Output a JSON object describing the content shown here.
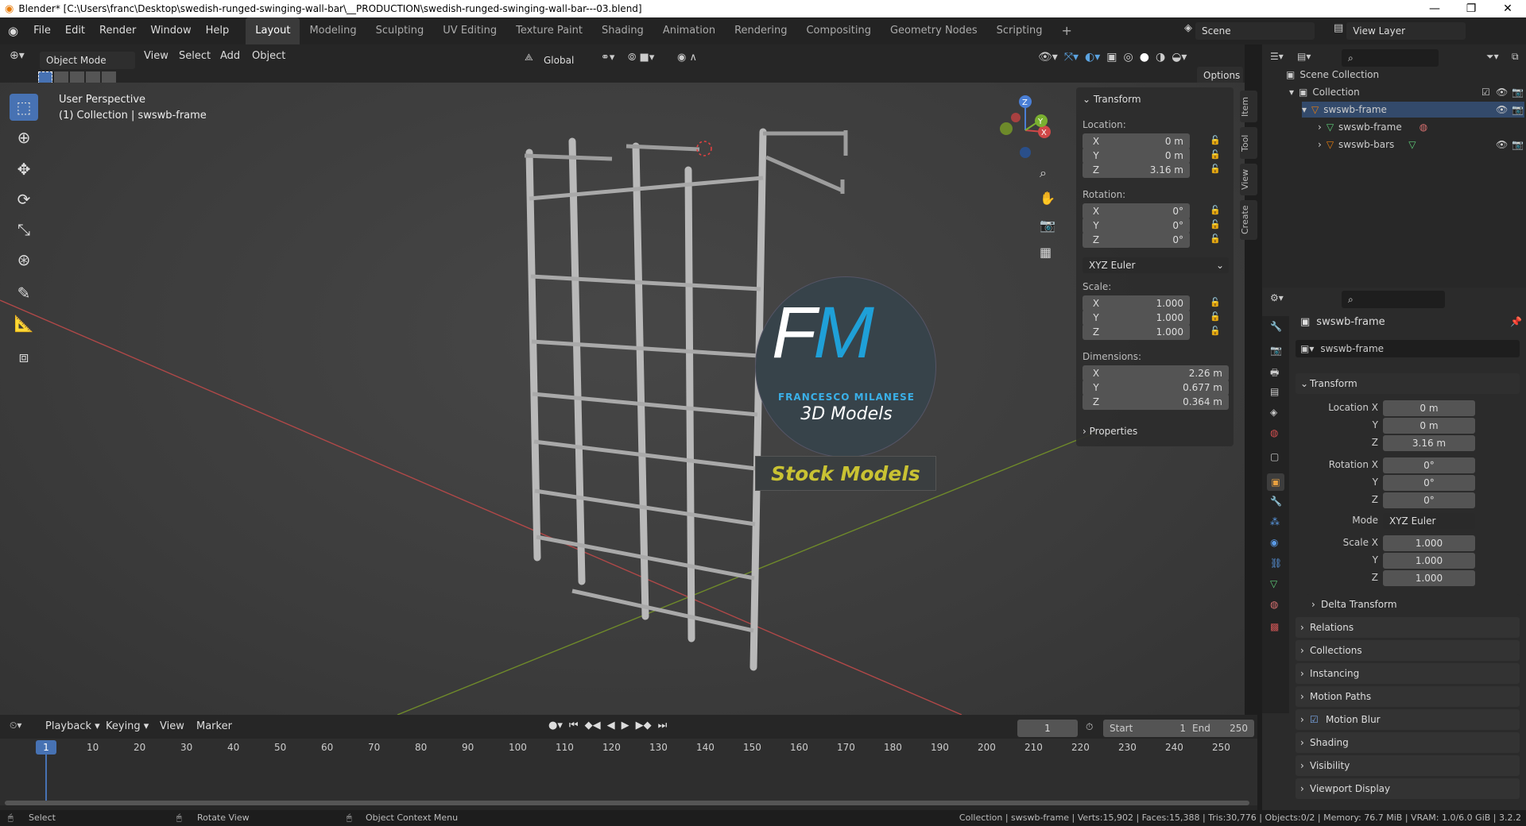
{
  "window": {
    "title": "Blender* [C:\\Users\\franc\\Desktop\\swedish-runged-swinging-wall-bar\\__PRODUCTION\\swedish-runged-swinging-wall-bar---03.blend]"
  },
  "menus": [
    "File",
    "Edit",
    "Render",
    "Window",
    "Help"
  ],
  "workspaces": [
    "Layout",
    "Modeling",
    "Sculpting",
    "UV Editing",
    "Texture Paint",
    "Shading",
    "Animation",
    "Rendering",
    "Compositing",
    "Geometry Nodes",
    "Scripting"
  ],
  "scene": "Scene",
  "view_layer": "View Layer",
  "viewport": {
    "mode": "Object Mode",
    "menus": [
      "View",
      "Select",
      "Add",
      "Object"
    ],
    "transform_orientation": "Global",
    "options": "Options",
    "perspective": "User Perspective",
    "collection_info": "(1) Collection | swswb-frame"
  },
  "watermark": {
    "letters": "FM",
    "name": "FRANCESCO MILANESE",
    "sub": "3D Models",
    "banner": "Stock Models"
  },
  "npanel": {
    "title": "Transform",
    "location_label": "Location:",
    "location": [
      {
        "ax": "X",
        "v": "0 m"
      },
      {
        "ax": "Y",
        "v": "0 m"
      },
      {
        "ax": "Z",
        "v": "3.16 m"
      }
    ],
    "rotation_label": "Rotation:",
    "rotation": [
      {
        "ax": "X",
        "v": "0°"
      },
      {
        "ax": "Y",
        "v": "0°"
      },
      {
        "ax": "Z",
        "v": "0°"
      }
    ],
    "rotation_mode": "XYZ Euler",
    "scale_label": "Scale:",
    "scale": [
      {
        "ax": "X",
        "v": "1.000"
      },
      {
        "ax": "Y",
        "v": "1.000"
      },
      {
        "ax": "Z",
        "v": "1.000"
      }
    ],
    "dimensions_label": "Dimensions:",
    "dimensions": [
      {
        "ax": "X",
        "v": "2.26 m"
      },
      {
        "ax": "Y",
        "v": "0.677 m"
      },
      {
        "ax": "Z",
        "v": "0.364 m"
      }
    ],
    "properties": "Properties",
    "tabs": [
      "Item",
      "Tool",
      "View",
      "Create"
    ]
  },
  "outliner": {
    "root": "Scene Collection",
    "collection": "Collection",
    "items": [
      "swswb-frame",
      "swswb-frame",
      "swswb-bars"
    ]
  },
  "properties": {
    "object_name": "swswb-frame",
    "data_name": "swswb-frame",
    "transform": "Transform",
    "fields": [
      {
        "label": "Location X",
        "v": "0 m"
      },
      {
        "label": "Y",
        "v": "0 m"
      },
      {
        "label": "Z",
        "v": "3.16 m"
      },
      {
        "label": "Rotation X",
        "v": "0°"
      },
      {
        "label": "Y",
        "v": "0°"
      },
      {
        "label": "Z",
        "v": "0°"
      },
      {
        "label": "Mode",
        "v": "XYZ Euler"
      },
      {
        "label": "Scale X",
        "v": "1.000"
      },
      {
        "label": "Y",
        "v": "1.000"
      },
      {
        "label": "Z",
        "v": "1.000"
      }
    ],
    "sections": [
      "Delta Transform",
      "Relations",
      "Collections",
      "Instancing",
      "Motion Paths",
      "Motion Blur",
      "Shading",
      "Visibility",
      "Viewport Display"
    ]
  },
  "timeline": {
    "menus": [
      "Playback",
      "Keying",
      "View",
      "Marker"
    ],
    "current_frame": "1",
    "start_label": "Start",
    "start": "1",
    "end_label": "End",
    "end": "250",
    "ruler": [
      "1",
      "10",
      "20",
      "30",
      "40",
      "50",
      "60",
      "70",
      "80",
      "90",
      "100",
      "110",
      "120",
      "130",
      "140",
      "150",
      "160",
      "170",
      "180",
      "190",
      "200",
      "210",
      "220",
      "230",
      "240",
      "250"
    ]
  },
  "status": {
    "select": "Select",
    "rotate": "Rotate View",
    "context": "Object Context Menu",
    "stats": "Collection | swswb-frame | Verts:15,902 | Faces:15,388 | Tris:30,776 | Objects:0/2 | Memory: 76.7 MiB | VRAM: 1.0/6.0 GiB | 3.2.2"
  }
}
